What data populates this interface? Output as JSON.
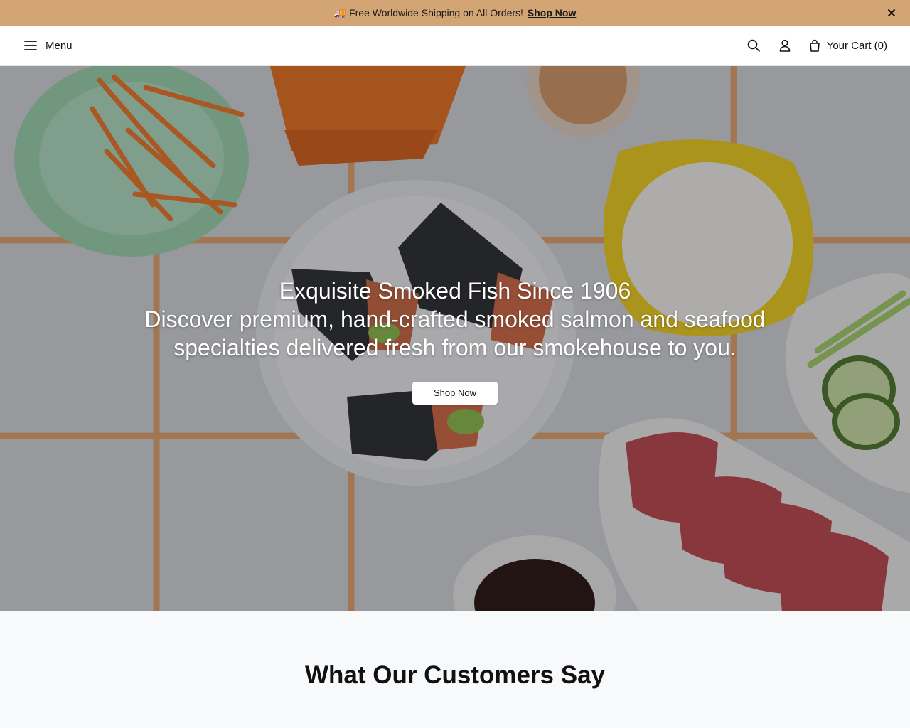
{
  "announcement": {
    "icon": "truck-icon",
    "text": "Free Worldwide Shipping on All Orders!",
    "link_label": "Shop Now"
  },
  "header": {
    "menu_label": "Menu",
    "cart_label": "Your Cart (0)"
  },
  "hero": {
    "title": "Exquisite Smoked Fish Since 1906",
    "subtitle": "Discover premium, hand-crafted smoked salmon and seafood specialties delivered fresh from our smokehouse to you.",
    "cta_label": "Shop Now"
  },
  "testimonials": {
    "heading": "What Our Customers Say"
  },
  "colors": {
    "announcement_bg": "#d4a574",
    "testimonials_bg": "#f8f9fb"
  }
}
